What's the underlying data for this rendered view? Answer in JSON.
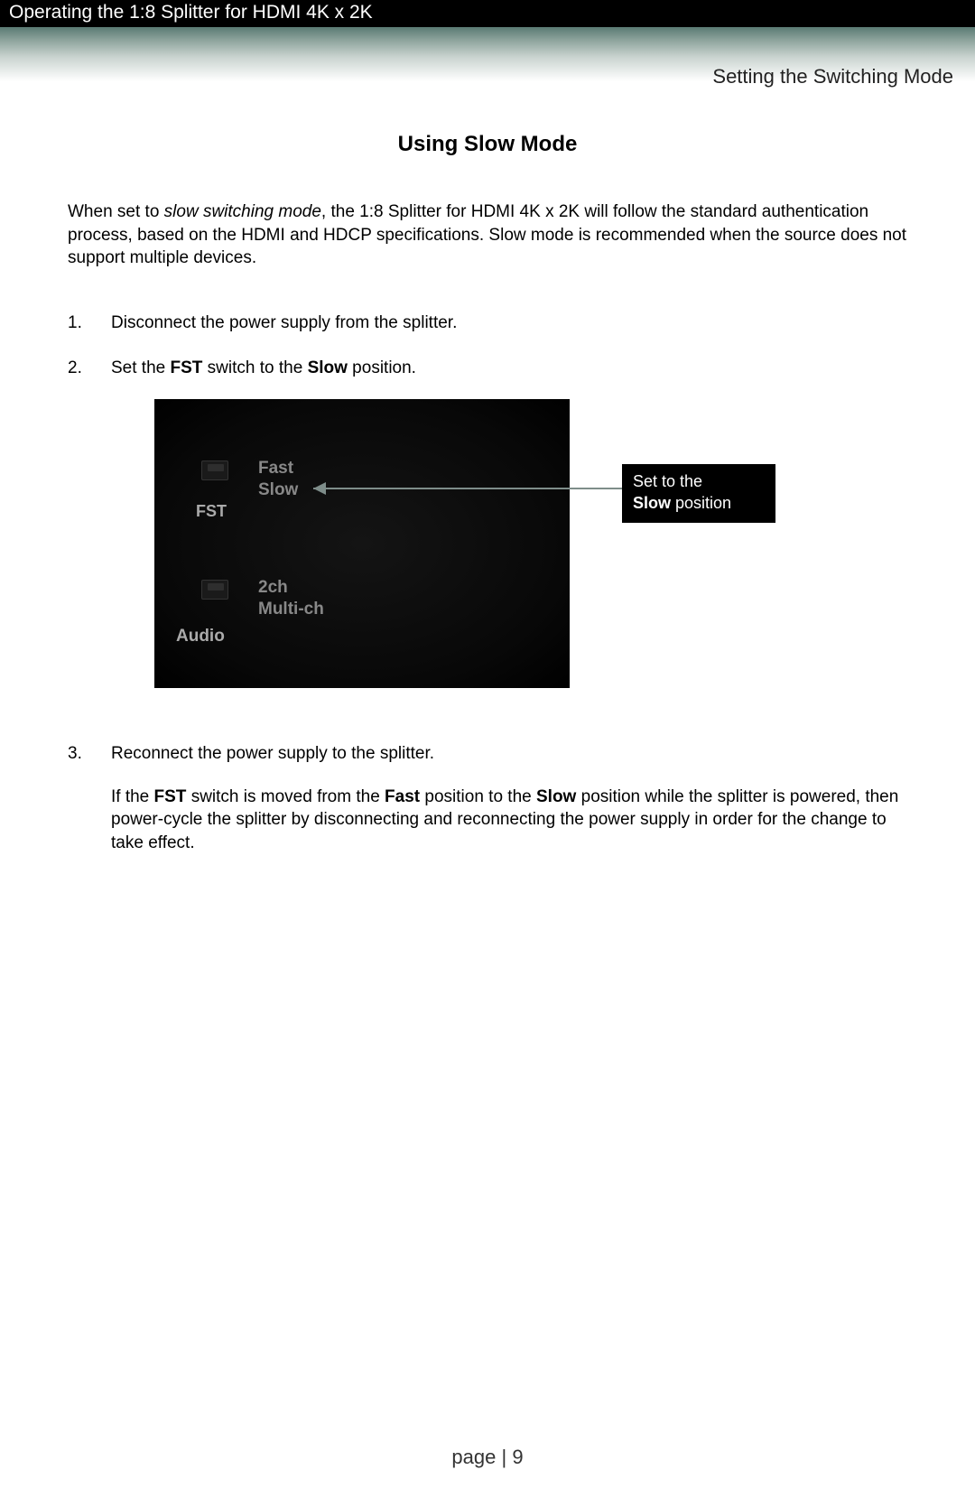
{
  "header": {
    "chapter_title": "Operating the 1:8 Splitter for HDMI 4K x 2K",
    "section_subhead": "Setting the Switching Mode"
  },
  "title": "Using Slow Mode",
  "intro": {
    "pre": "When set to ",
    "emph": "slow switching mode",
    "post": ", the 1:8 Splitter for HDMI 4K x 2K will follow the standard authentication process, based on the HDMI and HDCP specifications.  Slow mode is recommended when the source does not support multiple devices."
  },
  "steps": {
    "s1": "Disconnect the power supply from the splitter.",
    "s2_pre": "Set the ",
    "s2_b1": "FST",
    "s2_mid": " switch to the ",
    "s2_b2": "Slow",
    "s2_post": " position.",
    "s3": "Reconnect the power supply to the splitter.",
    "s3_note_pre": "If the ",
    "s3_note_b1": "FST",
    "s3_note_mid1": " switch is moved from the ",
    "s3_note_b2": "Fast",
    "s3_note_mid2": " position to the ",
    "s3_note_b3": "Slow",
    "s3_note_post": " position while the splitter is powered, then power-cycle the splitter by disconnecting and reconnecting the power supply in order for the change to take effect."
  },
  "device": {
    "fast": "Fast",
    "slow": "Slow",
    "fst": "FST",
    "twoch": "2ch",
    "multich": "Multi-ch",
    "audio": "Audio"
  },
  "callout": {
    "line1": "Set to the",
    "bold": "Slow",
    "line2_rest": " position"
  },
  "footer": {
    "label": "page | ",
    "number": "9"
  }
}
